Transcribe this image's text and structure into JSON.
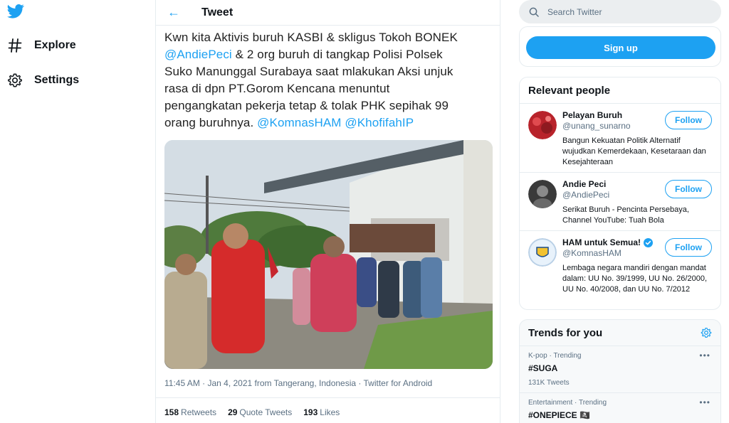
{
  "nav": {
    "logo": "twitter-bird-icon",
    "items": [
      {
        "label": "Explore",
        "icon": "hashtag-icon"
      },
      {
        "label": "Settings",
        "icon": "gear-icon"
      }
    ]
  },
  "header": {
    "title": "Tweet"
  },
  "tweet": {
    "text_lines": [
      "Kwn kita Aktivis buruh KASBI & skligus Tokoh BONEK",
      "& 2 org buruh di tangkap Polisi Polsek",
      "Suko Manunggal Surabaya saat mlakukan Aksi unjuk",
      "rasa di dpn PT.Gorom Kencana menuntut",
      "pengangkatan pekerja tetap & tolak PHK sepihak 99",
      "orang buruhnya."
    ],
    "mention_1": "@AndiePeci",
    "mention_2": "@KomnasHAM",
    "mention_3": "@KhofifahIP",
    "meta": "11:45 AM · Jan 4, 2021 from Tangerang, Indonesia · Twitter for Android",
    "retweets_count": "158",
    "retweets_label": "Retweets",
    "quotes_count": "29",
    "quotes_label": "Quote Tweets",
    "likes_count": "193",
    "likes_label": "Likes"
  },
  "search": {
    "placeholder": "Search Twitter"
  },
  "signup": {
    "label": "Sign up"
  },
  "relevant": {
    "title": "Relevant people",
    "follow_label": "Follow",
    "people": [
      {
        "name": "Pelayan Buruh",
        "handle": "@unang_sunarno",
        "bio": "Bangun Kekuatan Politik Alternatif wujudkan Kemerdekaan, Kesetaraan dan Kesejahteraan",
        "verified": false
      },
      {
        "name": "Andie Peci",
        "handle": "@AndiePeci",
        "bio": "Serikat Buruh - Pencinta Persebaya, Channel YouTube: Tuah Bola",
        "verified": false
      },
      {
        "name": "HAM untuk Semua!",
        "handle": "@KomnasHAM",
        "bio": "Lembaga negara mandiri dengan mandat dalam: UU No. 39/1999, UU No. 26/2000, UU No. 40/2008, dan UU No. 7/2012",
        "verified": true
      }
    ]
  },
  "trends": {
    "title": "Trends for you",
    "items": [
      {
        "category": "K-pop · Trending",
        "name": "#SUGA",
        "count": "131K Tweets"
      },
      {
        "category": "Entertainment · Trending",
        "name": "#ONEPIECE 🏴‍☠️",
        "count": ""
      }
    ]
  },
  "colors": {
    "accent": "#1da1f2",
    "border": "#e6ecf0",
    "muted": "#5b7083"
  }
}
